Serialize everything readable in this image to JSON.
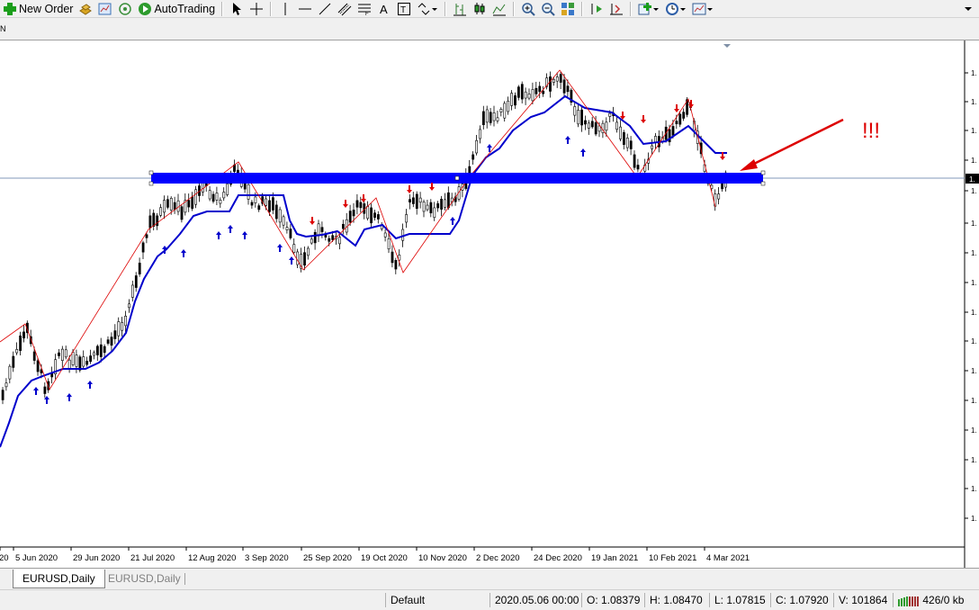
{
  "toolbar": {
    "new_order_label": "New Order",
    "auto_trading_label": "AutoTrading"
  },
  "subbar": {
    "left_fragment": "N"
  },
  "chart": {
    "annotation_text": "!!!",
    "colors": {
      "bull_body": "#2e7d32",
      "bear_body": "#000000",
      "trend_line": "#0000cc",
      "zigzag": "#dd0000",
      "support_band": "#0000ff",
      "arrow_up": "#0000cc",
      "arrow_down": "#dd0000",
      "annotation": "#dd0000",
      "price_line": "#8098b8"
    },
    "x_axis_labels": [
      "20",
      "5 Jun 2020",
      "29 Jun 2020",
      "21 Jul 2020",
      "12 Aug 2020",
      "3 Sep 2020",
      "25 Sep 2020",
      "19 Oct 2020",
      "10 Nov 2020",
      "2 Dec 2020",
      "24 Dec 2020",
      "19 Jan 2021",
      "10 Feb 2021",
      "4 Mar 2021"
    ],
    "y_axis_labels": [
      "1.",
      "1.",
      "1.",
      "1.",
      "1.",
      "1.",
      "1.",
      "1.",
      "1.",
      "1.",
      "1.",
      "1.",
      "1.",
      "1.",
      "1.",
      "1."
    ],
    "current_price_label": "1."
  },
  "tabs": [
    {
      "label": "EURUSD,Daily",
      "active": true
    },
    {
      "label": "EURUSD,Daily",
      "active": false
    }
  ],
  "status": {
    "profile": "Default",
    "datetime": "2020.05.06 00:00",
    "open": "O: 1.08379",
    "high": "H: 1.08470",
    "low": "L: 1.07815",
    "close": "C: 1.07920",
    "volume": "V: 101864",
    "traffic": "426/0 kb"
  }
}
